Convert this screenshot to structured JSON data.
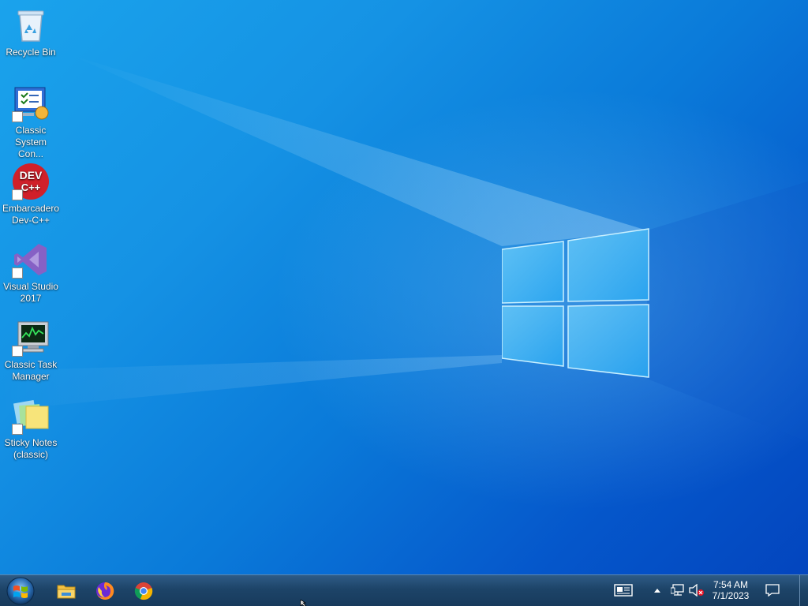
{
  "desktop": {
    "wallpaper": "windows-10-hero",
    "icons": [
      {
        "label": "Recycle Bin",
        "icon": "recycle-bin-icon",
        "shortcut": false
      },
      {
        "label": "Classic\nSystem Con...",
        "icon": "control-panel-icon",
        "shortcut": true
      },
      {
        "label": "Embarcadero\nDev-C++",
        "icon": "dev-cpp-icon",
        "shortcut": true,
        "badge": "DEV\nC++"
      },
      {
        "label": "Visual Studio\n2017",
        "icon": "visual-studio-icon",
        "shortcut": true
      },
      {
        "label": "Classic Task\nManager",
        "icon": "task-manager-icon",
        "shortcut": true
      },
      {
        "label": "Sticky Notes\n(classic)",
        "icon": "sticky-notes-icon",
        "shortcut": true
      }
    ]
  },
  "taskbar": {
    "start": {
      "icon": "windows-start-orb-icon"
    },
    "pinned": [
      {
        "name": "File Explorer",
        "icon": "folder-icon"
      },
      {
        "name": "Firefox",
        "icon": "firefox-icon"
      },
      {
        "name": "Chrome",
        "icon": "chrome-icon"
      }
    ],
    "tray": {
      "news_icon": "news-icon",
      "overflow_icon": "chevron-up-icon",
      "network_icon": "network-icon",
      "volume_icon": "volume-muted-icon",
      "notification_icon": "action-center-icon"
    },
    "clock": {
      "time": "7:54 AM",
      "date": "7/1/2023"
    }
  },
  "colors": {
    "taskbar": "#1d4468",
    "wallpaper_light": "#1aa3ec",
    "wallpaper_dark": "#0345be"
  }
}
